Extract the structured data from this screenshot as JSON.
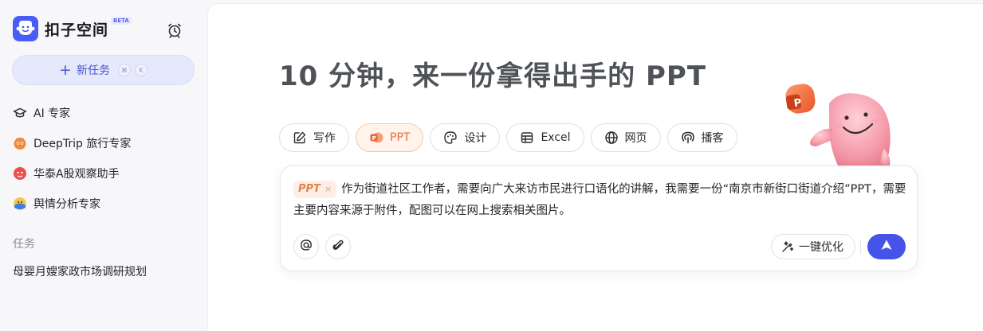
{
  "app": {
    "brand": "扣子空间",
    "badge": "BETA",
    "accent_color": "#4653e8"
  },
  "sidebar": {
    "new_task": {
      "label": "新任务",
      "shortcut_keys": [
        "⌘",
        "K"
      ]
    },
    "agents": [
      {
        "label": "AI 专家",
        "icon": "graduation-cap-icon"
      },
      {
        "label": "DeepTrip 旅行专家",
        "icon": "travel-avatar-icon"
      },
      {
        "label": "华泰A股观察助手",
        "icon": "stock-avatar-icon"
      },
      {
        "label": "舆情分析专家",
        "icon": "sentiment-avatar-icon"
      }
    ],
    "tasks_section_label": "任务",
    "tasks": [
      {
        "label": "母婴月嫂家政市场调研规划"
      }
    ]
  },
  "main": {
    "headline": "10 分钟，来一份拿得出手的 PPT",
    "mode_chips": [
      {
        "label": "写作",
        "icon": "pen-note-icon",
        "selected": false
      },
      {
        "label": "PPT",
        "icon": "ppt-icon",
        "selected": true
      },
      {
        "label": "设计",
        "icon": "palette-icon",
        "selected": false
      },
      {
        "label": "Excel",
        "icon": "table-icon",
        "selected": false
      },
      {
        "label": "网页",
        "icon": "globe-icon",
        "selected": false
      },
      {
        "label": "播客",
        "icon": "podcast-icon",
        "selected": false
      }
    ],
    "composer": {
      "tag_label": "PPT",
      "tag_remove": "×",
      "prompt_text": "作为街道社区工作者，需要向广大来访市民进行口语化的讲解，我需要一份“南京市新街口街道介绍”PPT，需要主要内容来源于附件，配图可以在网上搜索相关图片。",
      "optimize_label": "一键优化"
    }
  }
}
